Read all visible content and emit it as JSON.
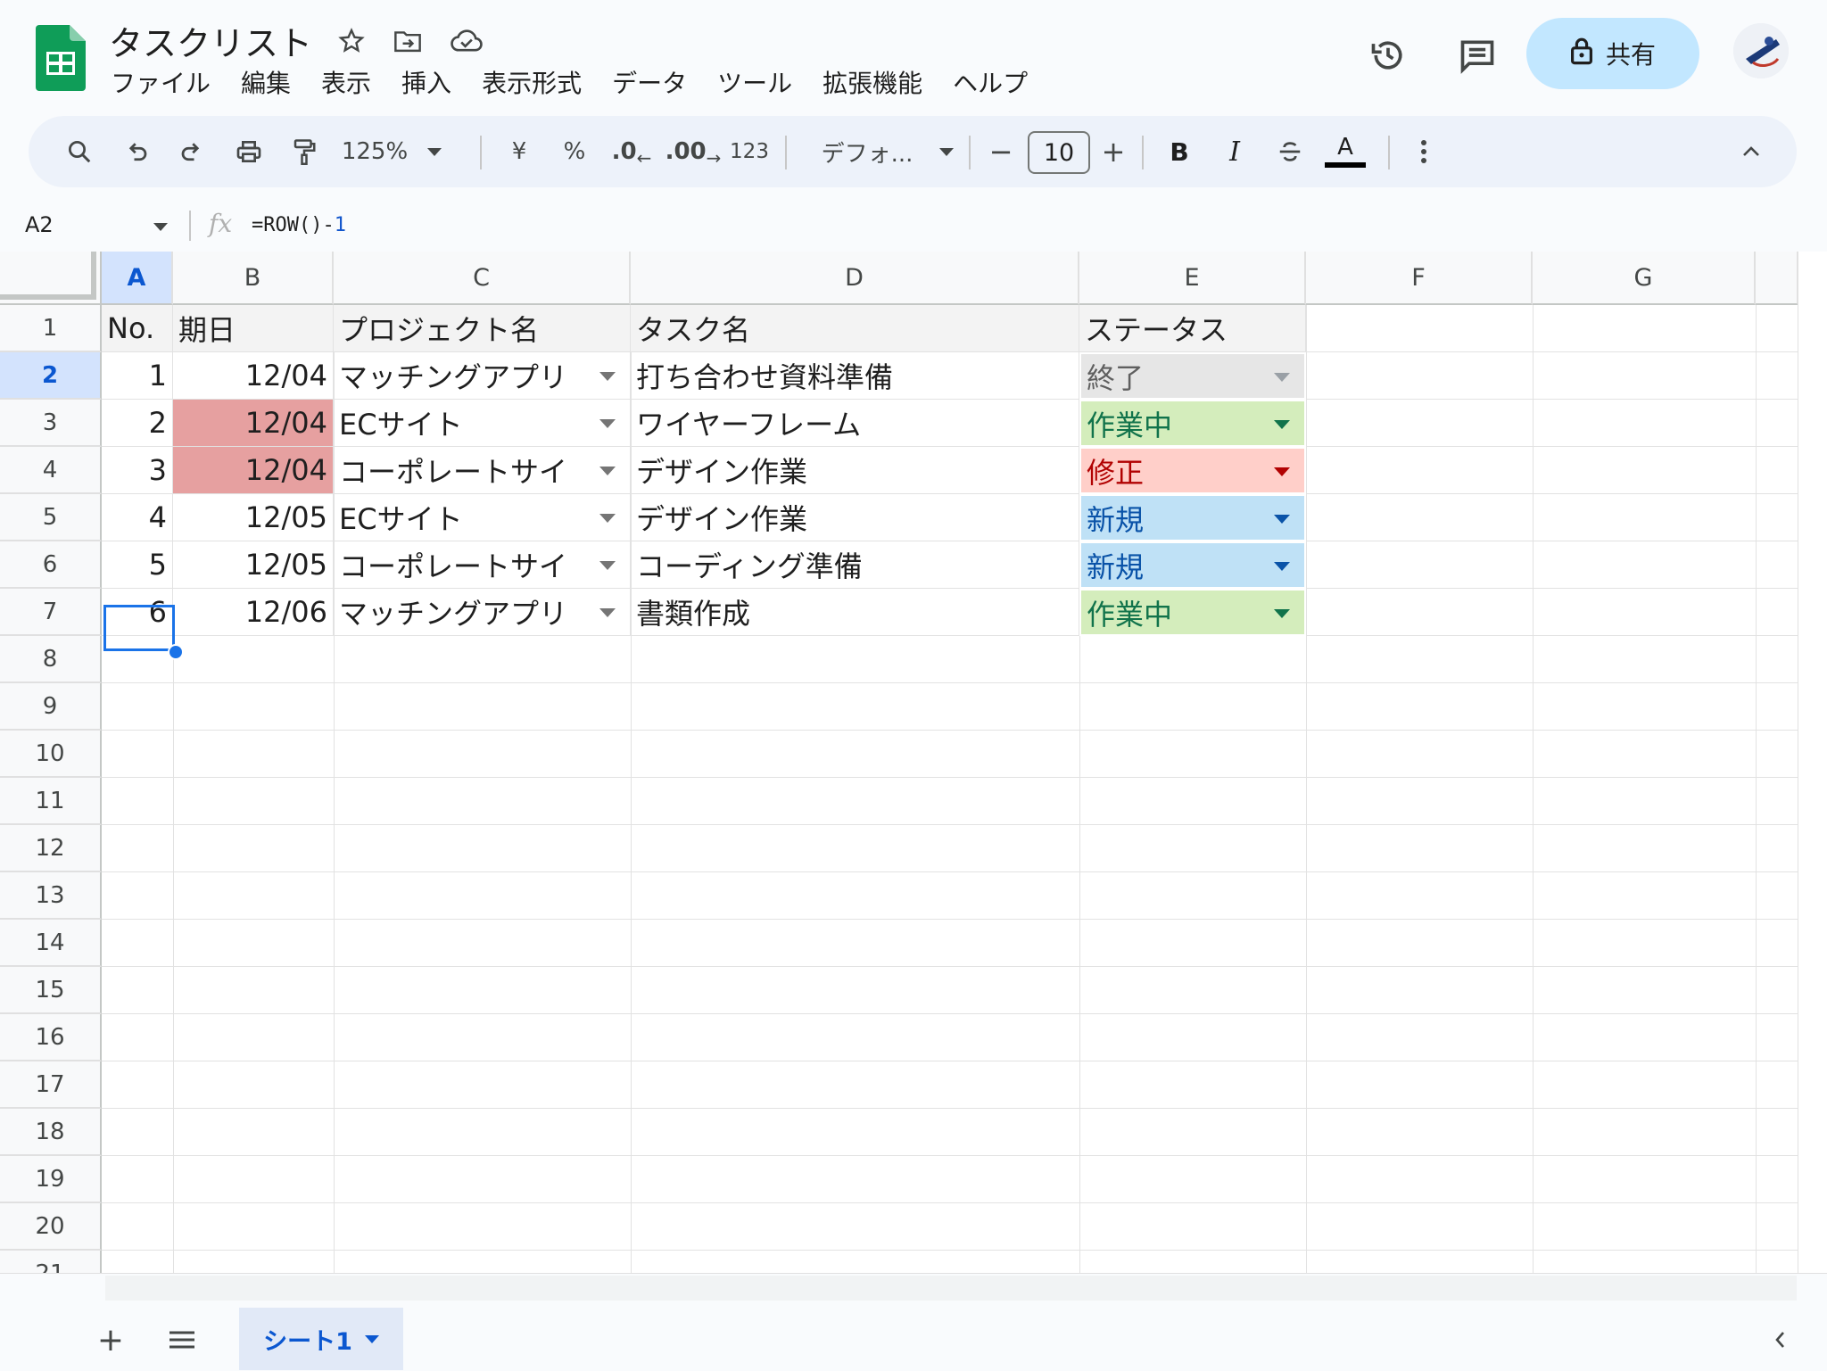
{
  "app": {
    "title": "タスクリスト",
    "menu": [
      "ファイル",
      "編集",
      "表示",
      "挿入",
      "表示形式",
      "データ",
      "ツール",
      "拡張機能",
      "ヘルプ"
    ],
    "share_label": "共有",
    "accent": "#c2e7ff"
  },
  "toolbar": {
    "zoom": "125%",
    "currency": "¥",
    "percent": "%",
    "decimal_decrease": ".0",
    "decimal_increase": ".00",
    "number_format": "123",
    "font": "デフォ...",
    "font_size": "10",
    "bold": "B",
    "italic": "I",
    "text_color": "A"
  },
  "formula_bar": {
    "name_box": "A2",
    "fx": "fx",
    "formula_text": "=ROW()-",
    "formula_num": "1"
  },
  "columns": [
    "A",
    "B",
    "C",
    "D",
    "E",
    "F",
    "G"
  ],
  "rows": [
    "1",
    "2",
    "3",
    "4",
    "5",
    "6",
    "7",
    "8",
    "9",
    "10",
    "11",
    "12",
    "13",
    "14",
    "15",
    "16",
    "17",
    "18",
    "19",
    "20",
    "21"
  ],
  "header_row": [
    "No.",
    "期日",
    "プロジェクト名",
    "タスク名",
    "ステータス"
  ],
  "data_rows": [
    {
      "no": "1",
      "date": "12/04",
      "project": "マッチングアプリ",
      "task": "打ち合わせ資料準備",
      "status": "終了",
      "date_bg": "#ffffff",
      "status_bg": "#e6e6e6",
      "status_color": "#5f5f5f",
      "arrow_color": "#9aa0a6"
    },
    {
      "no": "2",
      "date": "12/04",
      "project": "ECサイト",
      "task": "ワイヤーフレーム",
      "status": "作業中",
      "date_bg": "#e6a0a0",
      "status_bg": "#d4edbc",
      "status_color": "#11734b",
      "arrow_color": "#11734b"
    },
    {
      "no": "3",
      "date": "12/04",
      "project": "コーポレートサイ",
      "task": "デザイン作業",
      "status": "修正",
      "date_bg": "#e6a0a0",
      "status_bg": "#ffcfc9",
      "status_color": "#b10202",
      "arrow_color": "#b10202"
    },
    {
      "no": "4",
      "date": "12/05",
      "project": "ECサイト",
      "task": "デザイン作業",
      "status": "新規",
      "date_bg": "#ffffff",
      "status_bg": "#bfe1f6",
      "status_color": "#0a53a8",
      "arrow_color": "#0a53a8"
    },
    {
      "no": "5",
      "date": "12/05",
      "project": "コーポレートサイ",
      "task": "コーディング準備",
      "status": "新規",
      "date_bg": "#ffffff",
      "status_bg": "#bfe1f6",
      "status_color": "#0a53a8",
      "arrow_color": "#0a53a8"
    },
    {
      "no": "6",
      "date": "12/06",
      "project": "マッチングアプリ",
      "task": "書類作成",
      "status": "作業中",
      "date_bg": "#ffffff",
      "status_bg": "#d4edbc",
      "status_color": "#11734b",
      "arrow_color": "#11734b"
    }
  ],
  "sheet_tab": "シート1"
}
